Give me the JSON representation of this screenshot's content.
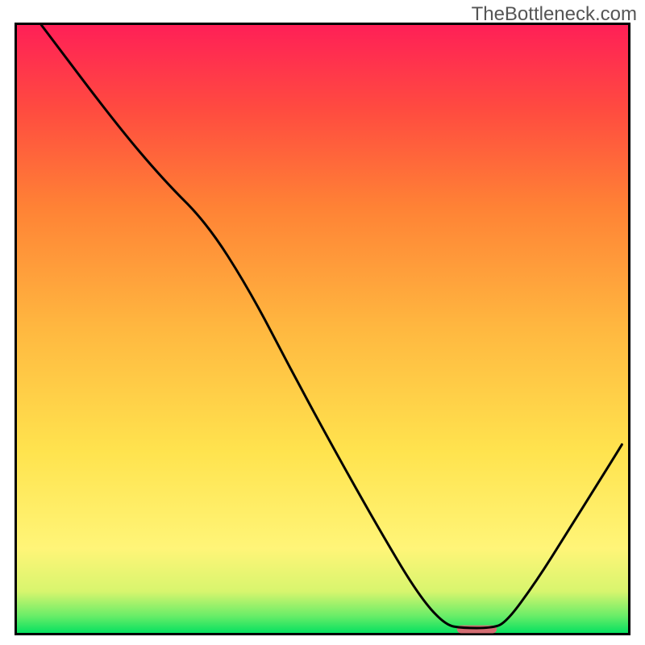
{
  "watermark": "TheBottleneck.com",
  "chart_data": {
    "type": "line",
    "title": "",
    "xlabel": "",
    "ylabel": "",
    "x_range_pct": [
      0.0,
      100.0
    ],
    "y_range_pct": [
      0.0,
      100.0
    ],
    "gradient_name": "heatmap-green-yellow-red",
    "gradient": [
      {
        "stop": 0.0,
        "color": "#00e060"
      },
      {
        "stop": 0.03,
        "color": "#6aed68"
      },
      {
        "stop": 0.07,
        "color": "#d8f56e"
      },
      {
        "stop": 0.14,
        "color": "#fff578"
      },
      {
        "stop": 0.3,
        "color": "#ffe34e"
      },
      {
        "stop": 0.5,
        "color": "#ffb840"
      },
      {
        "stop": 0.7,
        "color": "#ff8235"
      },
      {
        "stop": 0.86,
        "color": "#ff4b40"
      },
      {
        "stop": 1.0,
        "color": "#ff1f57"
      }
    ],
    "series": [
      {
        "name": "bottleneck-curve",
        "stroke": "#000000",
        "points_pct": [
          [
            4.0,
            100.0
          ],
          [
            16.0,
            84.0
          ],
          [
            24.0,
            74.5
          ],
          [
            31.0,
            67.5
          ],
          [
            38.0,
            56.5
          ],
          [
            45.0,
            43.0
          ],
          [
            52.0,
            30.0
          ],
          [
            59.0,
            17.5
          ],
          [
            65.5,
            6.5
          ],
          [
            70.0,
            1.3
          ],
          [
            73.0,
            0.8
          ],
          [
            77.5,
            0.8
          ],
          [
            80.0,
            1.6
          ],
          [
            85.0,
            8.5
          ],
          [
            90.0,
            16.5
          ],
          [
            95.0,
            24.5
          ],
          [
            99.0,
            31.0
          ]
        ]
      }
    ],
    "marker": {
      "name": "valley-marker",
      "shape": "rounded-bar",
      "color": "#d36d72",
      "x_pct": [
        72.0,
        78.5
      ],
      "y_pct": 0.6,
      "thickness_pct": 1.3
    }
  }
}
